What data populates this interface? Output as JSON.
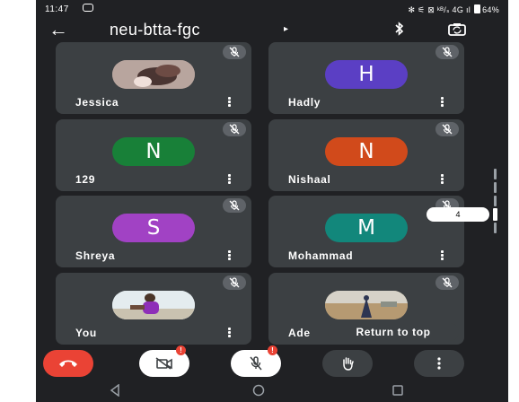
{
  "status_bar": {
    "time": "11:47",
    "right_text": "✻ ⚟ ⊠ ᵏᴮ/ₛ 4G ıl",
    "battery": "64%"
  },
  "header": {
    "back_icon": "arrow-left-icon",
    "meeting_code": "neu-btta-fgc",
    "caret": "▸"
  },
  "participants": [
    {
      "name": "Jessica",
      "avatar_type": "photo",
      "muted": true
    },
    {
      "name": "Hadly",
      "initial": "H",
      "color": "#5b3fc4",
      "muted": true
    },
    {
      "name": "129",
      "initial": "N",
      "color": "#188038",
      "muted": true
    },
    {
      "name": "Nishaal",
      "initial": "N",
      "color": "#d14a1b",
      "muted": true
    },
    {
      "name": "Shreya",
      "initial": "S",
      "color": "#a142c4",
      "muted": true
    },
    {
      "name": "Mohammad",
      "initial": "M",
      "color": "#12877b",
      "muted": true
    },
    {
      "name": "You",
      "avatar_type": "photo",
      "muted": true
    },
    {
      "name": "Ade",
      "avatar_type": "photo",
      "muted": true
    }
  ],
  "page_indicator": "4",
  "return_to_top": "Return to top",
  "controls": {
    "end_call": {
      "color": "#ea4335"
    },
    "camera": {
      "badge": "!"
    },
    "mic": {
      "badge": "!"
    },
    "raise_hand": {},
    "more": {}
  },
  "colors": {
    "tile_bg": "#3c4043",
    "screen_bg": "#202124"
  }
}
